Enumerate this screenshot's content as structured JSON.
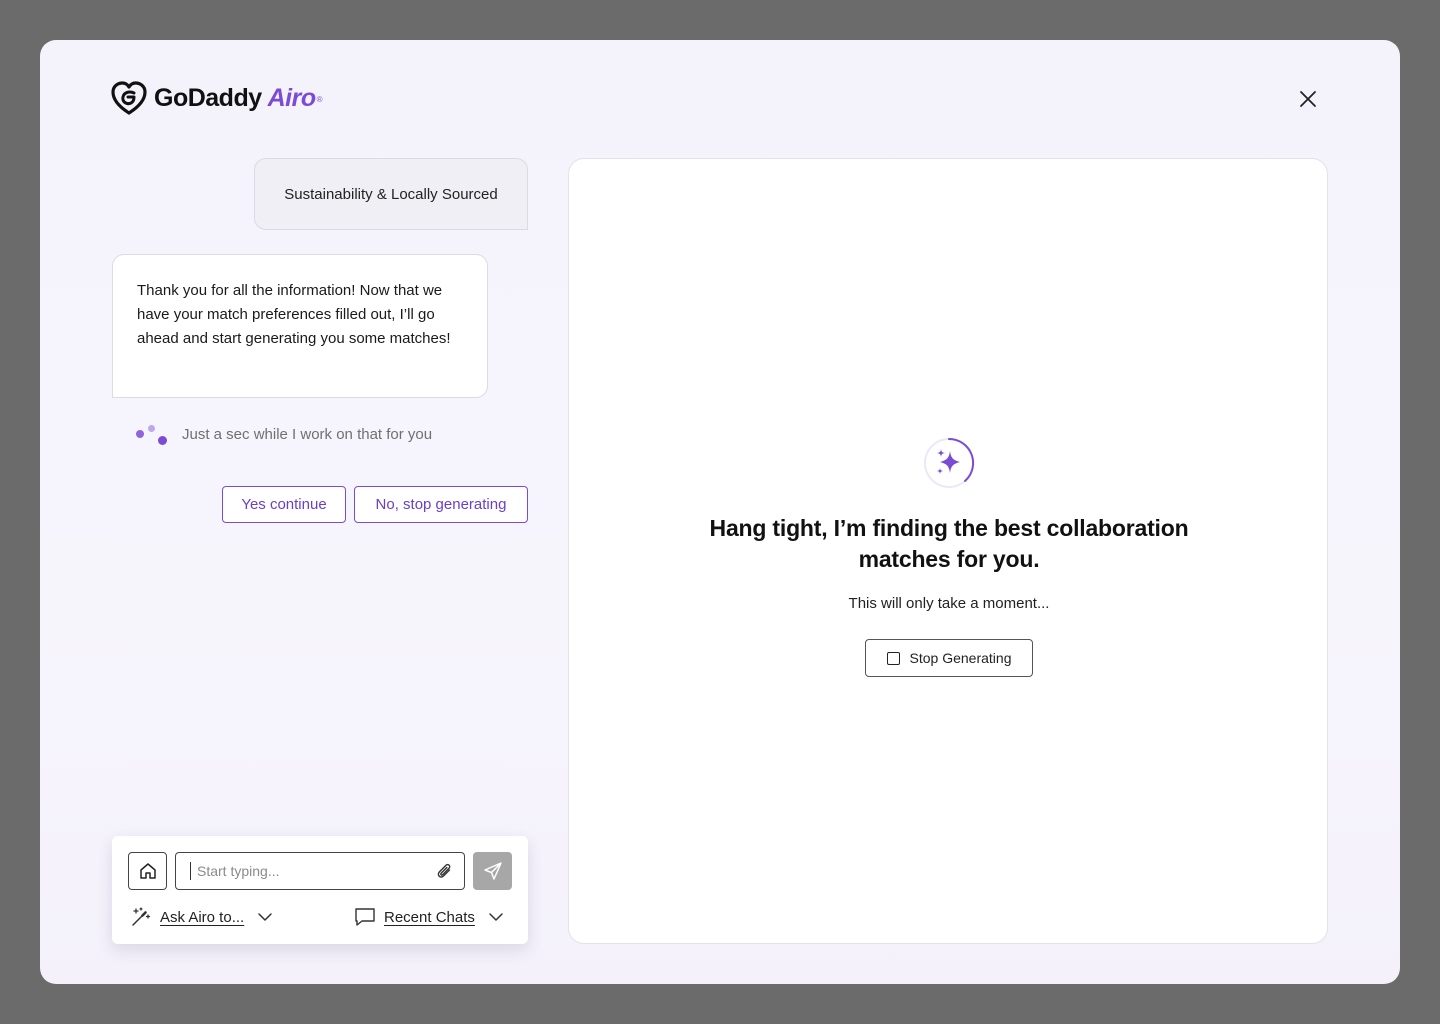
{
  "header": {
    "brand_name": "GoDaddy",
    "product_name": "Airo",
    "registered_mark": "®"
  },
  "chat": {
    "user_message": "Sustainability & Locally Sourced",
    "bot_message": "Thank you for all the information! Now that we have your match preferences filled out, I’ll go ahead and start generating you some matches!",
    "typing_status": "Just a sec while I work on that for you",
    "actions": {
      "yes_label": "Yes continue",
      "no_label": "No, stop generating"
    }
  },
  "composer": {
    "placeholder": "Start typing...",
    "ask_label": "Ask Airo to...",
    "recent_label": "Recent Chats"
  },
  "panel": {
    "headline_line1": "Hang tight, I’m finding the best collaboration",
    "headline_line2": "matches for you.",
    "subline": "This will only take a moment...",
    "stop_label": "Stop Generating"
  },
  "colors": {
    "accent": "#7b4bd6",
    "send_button": "#a7a7a7",
    "backdrop": "#6b6b6b"
  }
}
